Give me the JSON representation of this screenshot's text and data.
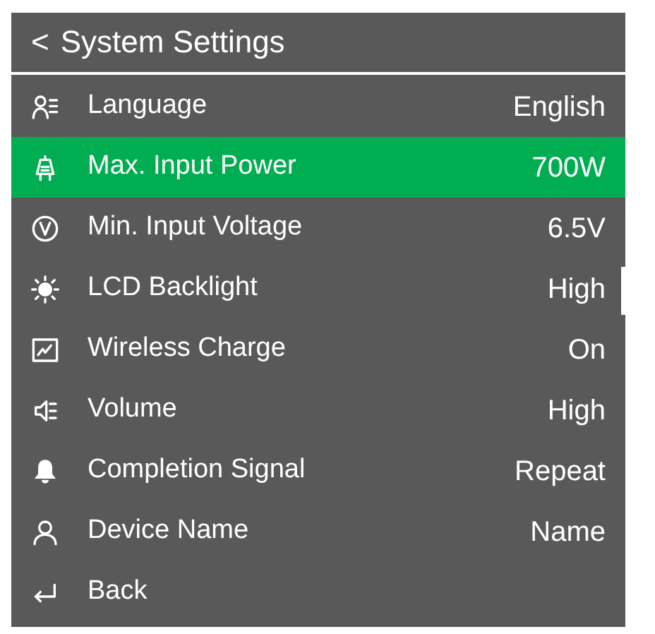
{
  "header": {
    "back": "<",
    "title": "System Settings"
  },
  "items": [
    {
      "label": "Language",
      "value": "English",
      "selected": false
    },
    {
      "label": "Max. Input Power",
      "value": "700W",
      "selected": true
    },
    {
      "label": "Min. Input Voltage",
      "value": "6.5V",
      "selected": false
    },
    {
      "label": "LCD Backlight",
      "value": "High",
      "selected": false
    },
    {
      "label": "Wireless Charge",
      "value": "On",
      "selected": false
    },
    {
      "label": "Volume",
      "value": "High",
      "selected": false
    },
    {
      "label": "Completion Signal",
      "value": "Repeat",
      "selected": false
    },
    {
      "label": "Device Name",
      "value": "Name",
      "selected": false
    },
    {
      "label": "Back",
      "selected": false
    }
  ]
}
